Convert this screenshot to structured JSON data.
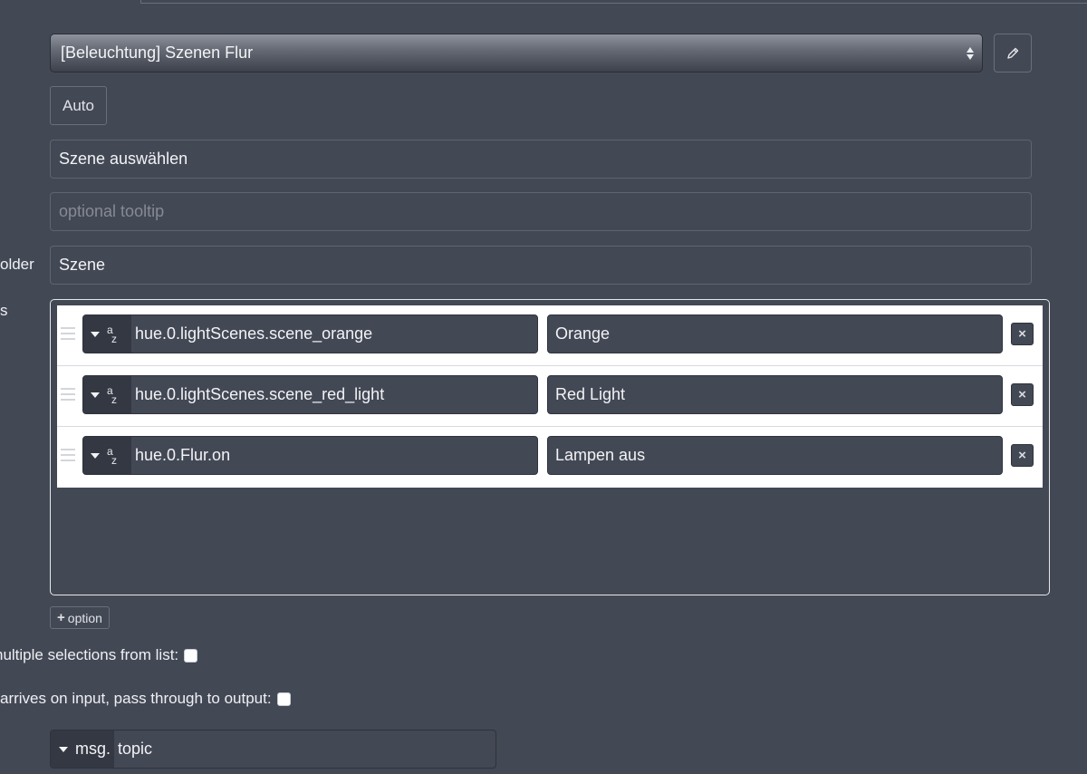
{
  "group_select": {
    "value": "[Beleuchtung] Szenen Flur"
  },
  "edit_icon": "pencil-icon",
  "size_button": {
    "label": "Auto"
  },
  "label_field": {
    "value": "Szene auswählen"
  },
  "tooltip_field": {
    "value": "",
    "placeholder": "optional tooltip"
  },
  "placeholder_row": {
    "label": "older",
    "value": "Szene"
  },
  "options_row": {
    "label": "s"
  },
  "options": [
    {
      "value": "hue.0.lightScenes.scene_orange",
      "label": "Orange",
      "remove": "×"
    },
    {
      "value": "hue.0.lightScenes.scene_red_light",
      "label": "Red Light",
      "remove": "×"
    },
    {
      "value": "hue.0.Flur.on",
      "label": "Lampen aus",
      "remove": "×"
    }
  ],
  "type_icon": {
    "a": "a",
    "z": "z"
  },
  "add_option_button": {
    "plus": "+",
    "label": "option"
  },
  "multiple_selections": {
    "label": "nultiple selections from list:"
  },
  "pass_through": {
    "label": "arrives on input, pass through to output:"
  },
  "topic_input": {
    "type": "msg.",
    "value": "topic"
  }
}
